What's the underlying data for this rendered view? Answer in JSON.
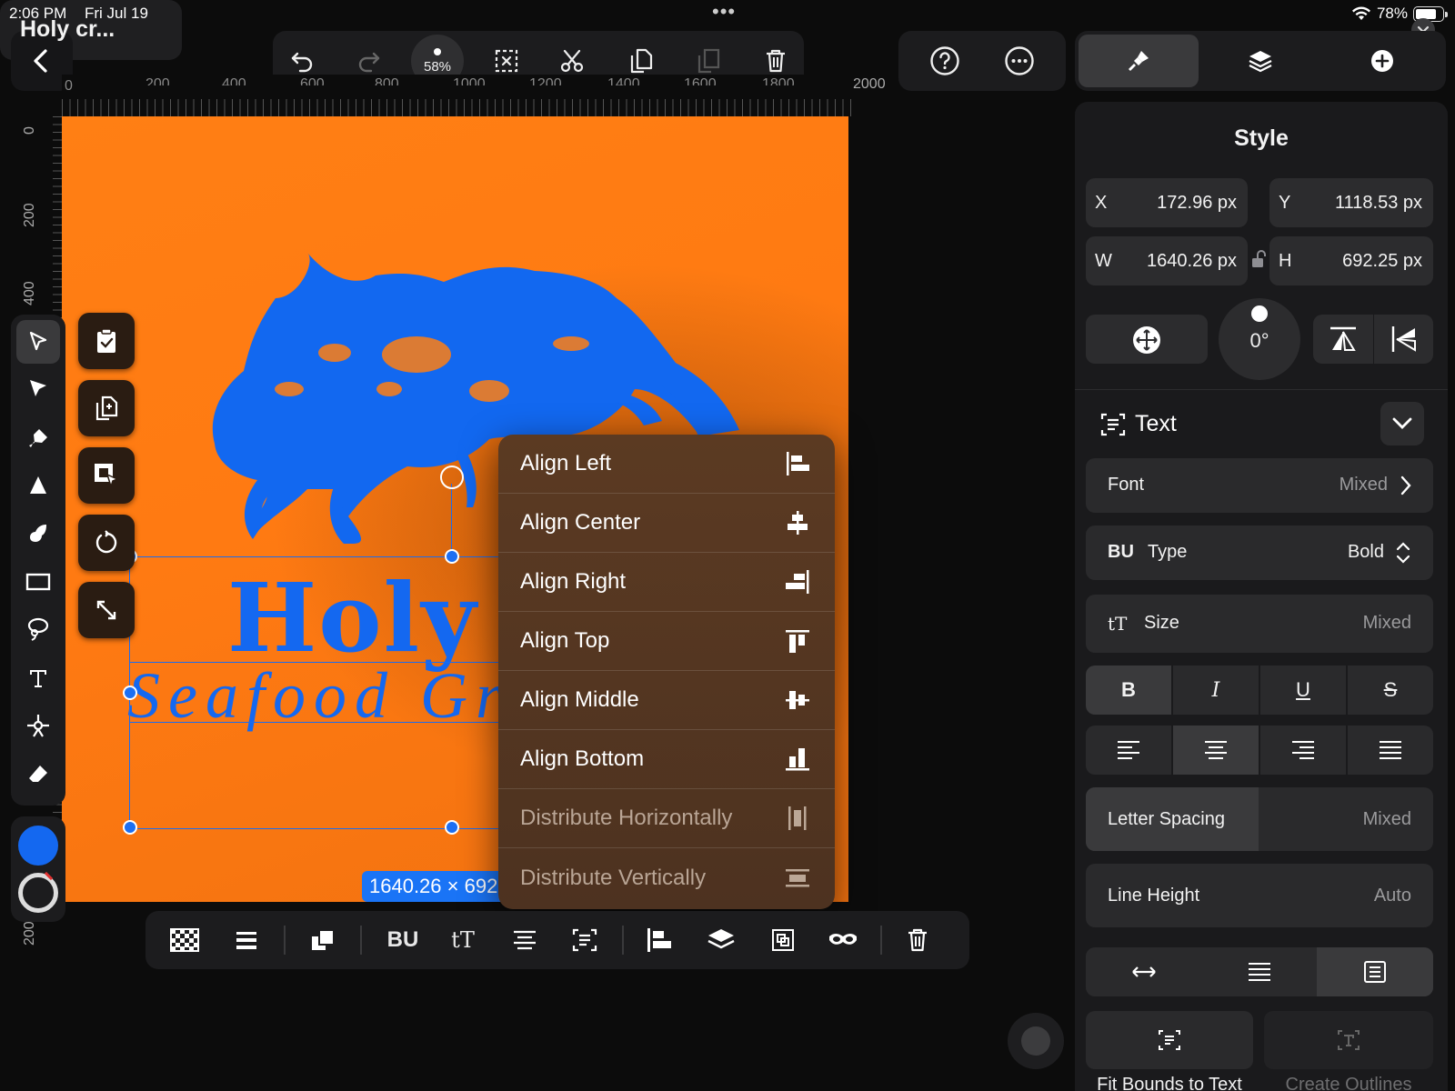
{
  "status": {
    "time": "2:06 PM",
    "date": "Fri Jul 19",
    "battery": "78%",
    "battery_level": 0.78
  },
  "document": {
    "title": "Holy cr..."
  },
  "toolbar": {
    "zoom": "58%"
  },
  "ruler": {
    "top": [
      "0",
      "200",
      "400",
      "600",
      "800",
      "1000",
      "1200",
      "1400",
      "1600",
      "1800",
      "2000"
    ],
    "left": [
      "0",
      "200",
      "400",
      "2000"
    ]
  },
  "artwork": {
    "headline": "Holy C",
    "subline": "Seafood Gri",
    "color": "#1468f0",
    "background": "#ff7f14"
  },
  "selection": {
    "dimensions": "1640.26 × 692.25"
  },
  "context_menu": {
    "items": [
      {
        "label": "Align Left",
        "enabled": true,
        "icon": "align-left-icon"
      },
      {
        "label": "Align Center",
        "enabled": true,
        "icon": "align-center-icon"
      },
      {
        "label": "Align Right",
        "enabled": true,
        "icon": "align-right-icon"
      },
      {
        "label": "Align Top",
        "enabled": true,
        "icon": "align-top-icon"
      },
      {
        "label": "Align Middle",
        "enabled": true,
        "icon": "align-middle-icon"
      },
      {
        "label": "Align Bottom",
        "enabled": true,
        "icon": "align-bottom-icon"
      },
      {
        "label": "Distribute Horizontally",
        "enabled": false,
        "icon": "distribute-horizontal-icon"
      },
      {
        "label": "Distribute Vertically",
        "enabled": false,
        "icon": "distribute-vertical-icon"
      }
    ]
  },
  "bottom_toolbar": {
    "bu_label": "BU",
    "tt_label": "tT"
  },
  "panel": {
    "title": "Style",
    "x_label": "X",
    "x_value": "172.96 px",
    "y_label": "Y",
    "y_value": "1118.53 px",
    "w_label": "W",
    "w_value": "1640.26 px",
    "h_label": "H",
    "h_value": "692.25 px",
    "rotation": "0°",
    "text_section": "Text",
    "font_label": "Font",
    "font_value": "Mixed",
    "type_prefix": "BU",
    "type_label": "Type",
    "type_value": "Bold",
    "size_label": "Size",
    "size_value": "Mixed",
    "style_bold": "B",
    "style_italic": "I",
    "style_underline": "U",
    "style_strike": "S",
    "letter_spacing_label": "Letter Spacing",
    "letter_spacing_value": "Mixed",
    "line_height_label": "Line Height",
    "line_height_value": "Auto",
    "fit_bounds": "Fit Bounds to Text",
    "create_outlines": "Create Outlines"
  },
  "colors": {
    "accent": "#1a6cf0",
    "fill": "#1468f0"
  }
}
